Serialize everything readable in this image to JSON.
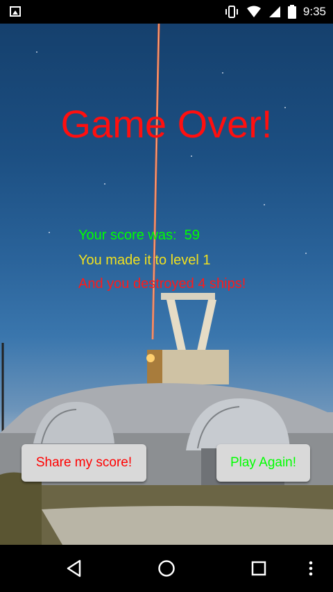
{
  "status_bar": {
    "time": "9:35",
    "icons": [
      "gallery-icon",
      "vibrate-icon",
      "wifi-icon",
      "signal-icon",
      "battery-icon"
    ]
  },
  "game_over": {
    "title": "Game Over!",
    "score_line": "Your score was:  59",
    "level_line": "You made it to level 1",
    "ships_line": "And you destroyed 4 ships!"
  },
  "buttons": {
    "share_label": "Share my score!",
    "play_again_label": "Play Again!"
  },
  "nav_bar": {
    "icons": [
      "back-icon",
      "home-icon",
      "recents-icon",
      "more-options-icon"
    ]
  },
  "colors": {
    "title": "#ff0f0f",
    "score": "#00ff00",
    "level": "#f0e020",
    "ships": "#ff1a1a",
    "laser": "#ff6a3d"
  }
}
